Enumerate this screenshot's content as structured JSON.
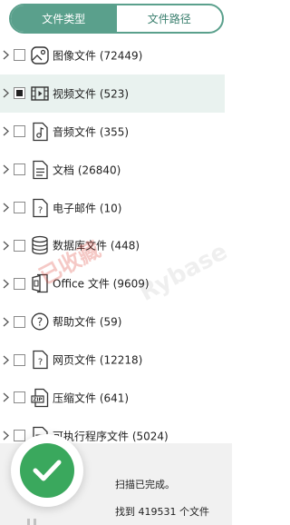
{
  "tabs": {
    "file_type": "文件类型",
    "file_path": "文件路径"
  },
  "items": [
    {
      "label": "图像文件 (72449)",
      "icon": "image-file-icon",
      "selected": false
    },
    {
      "label": "视频文件 (523)",
      "icon": "video-file-icon",
      "selected": true
    },
    {
      "label": "音频文件 (355)",
      "icon": "audio-file-icon",
      "selected": false
    },
    {
      "label": "文档 (26840)",
      "icon": "document-file-icon",
      "selected": false
    },
    {
      "label": "电子邮件 (10)",
      "icon": "email-file-icon",
      "selected": false
    },
    {
      "label": "数据库文件 (448)",
      "icon": "database-icon",
      "selected": false
    },
    {
      "label": "Office 文件 (9609)",
      "icon": "office-file-icon",
      "selected": false
    },
    {
      "label": "帮助文件 (59)",
      "icon": "help-file-icon",
      "selected": false
    },
    {
      "label": "网页文件 (12218)",
      "icon": "web-file-icon",
      "selected": false
    },
    {
      "label": "压缩文件 (641)",
      "icon": "zip-file-icon",
      "selected": false
    },
    {
      "label": "可执行程序文件 (5024)",
      "icon": "executable-file-icon",
      "selected": false
    }
  ],
  "watermark": {
    "text1": "已收藏",
    "text2": "Rybase"
  },
  "status": {
    "scan_done": "扫描已完成。",
    "found": "找到 419531 个文件"
  },
  "colors": {
    "accent": "#5aa08c",
    "selected_row": "#e9f2ef",
    "success": "#3aa85d"
  }
}
